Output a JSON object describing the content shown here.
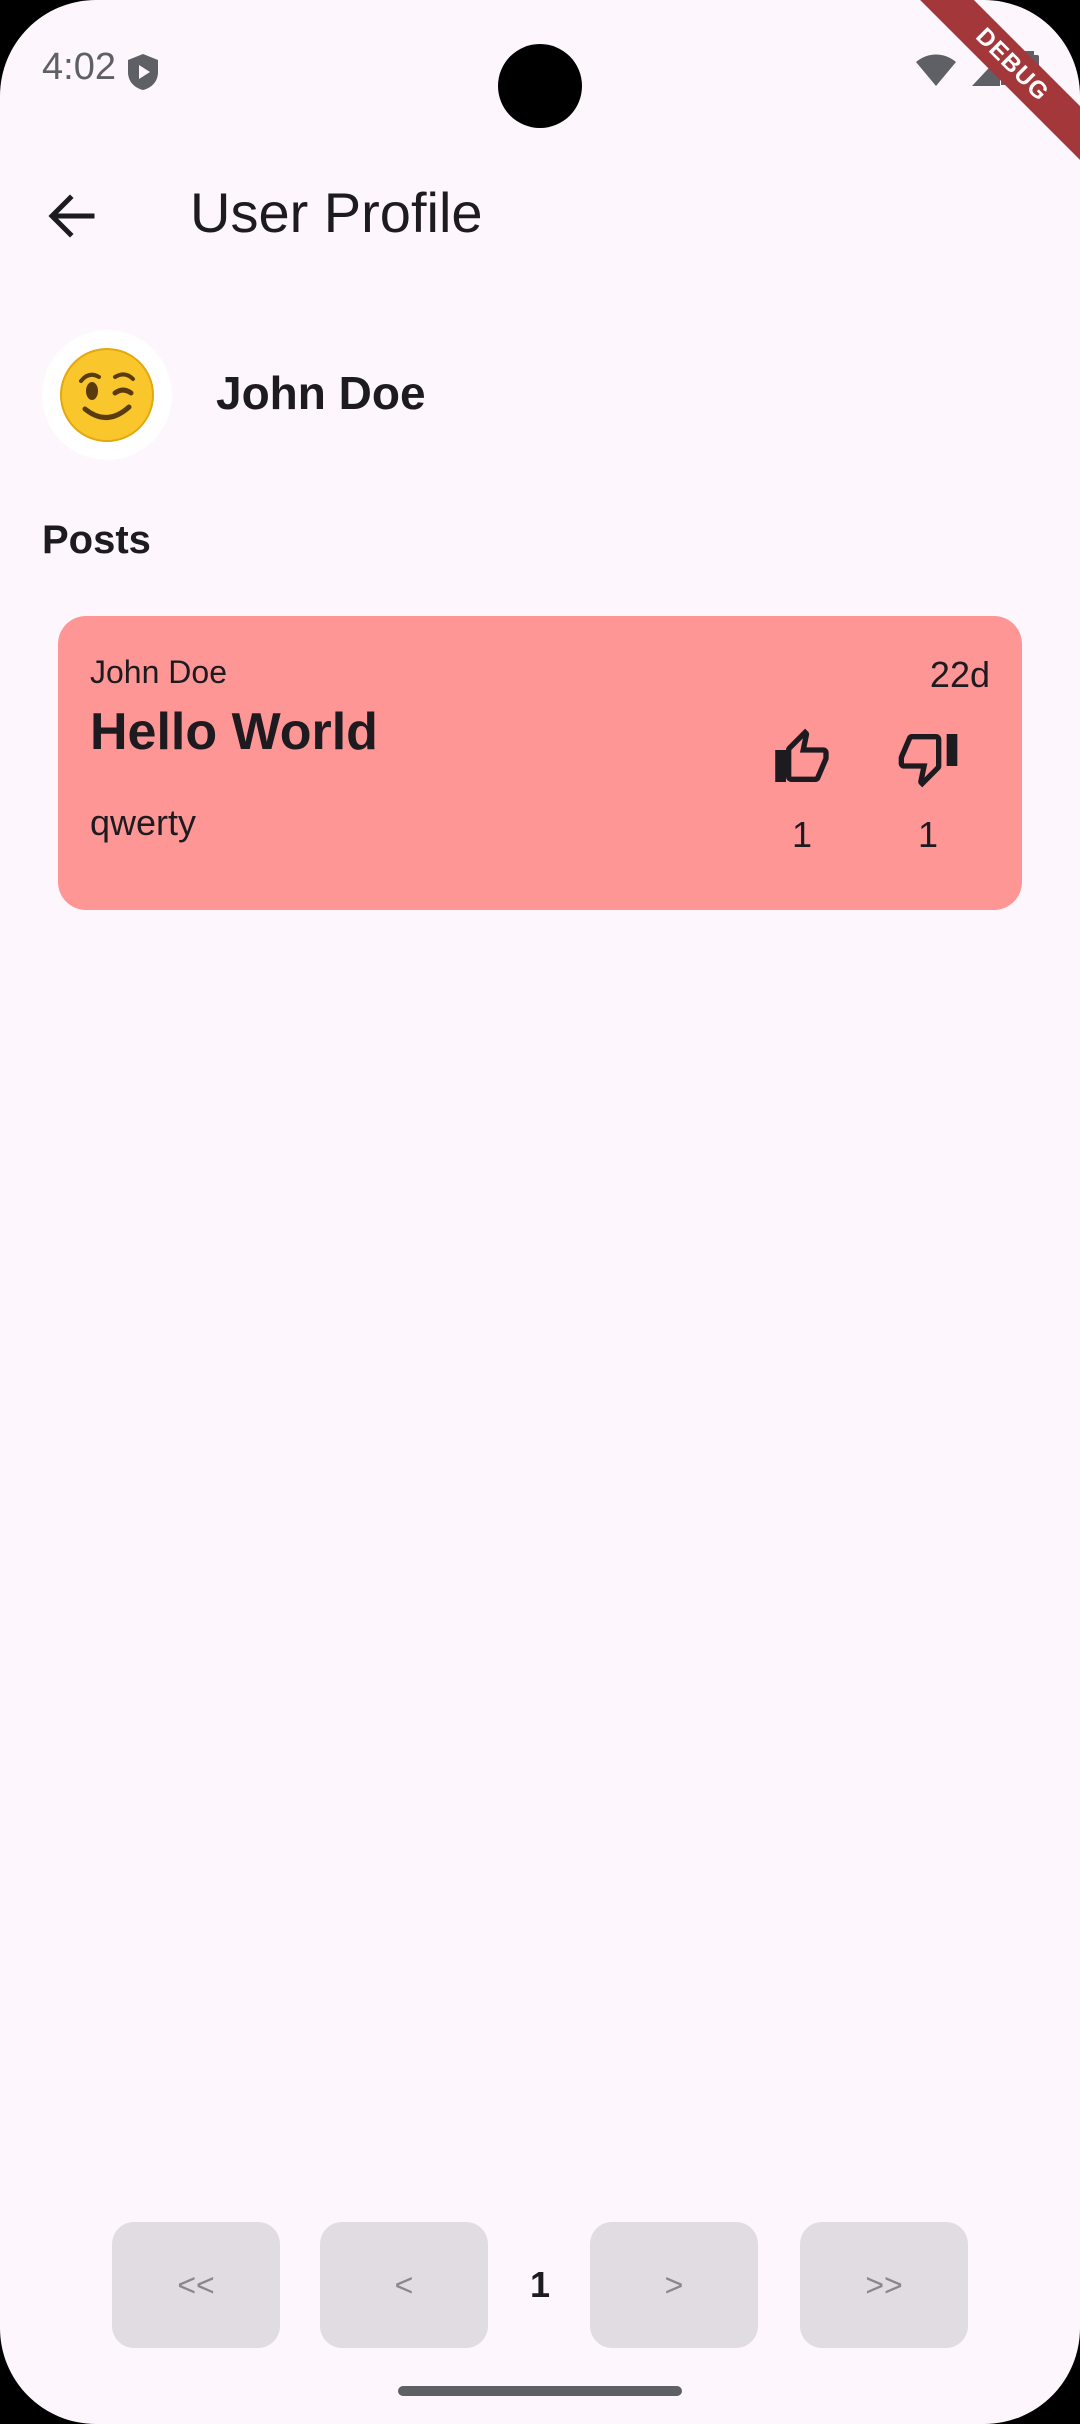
{
  "status_bar": {
    "time": "4:02"
  },
  "debug_banner": "DEBUG",
  "app_bar": {
    "title": "User Profile"
  },
  "profile": {
    "avatar_emoji": "😉",
    "name": "John Doe"
  },
  "posts_section": {
    "title": "Posts"
  },
  "posts": [
    {
      "author": "John Doe",
      "time_ago": "22d",
      "title": "Hello World",
      "body": "qwerty",
      "likes": "1",
      "dislikes": "1"
    }
  ],
  "pagination": {
    "first_label": "<<",
    "prev_label": "<",
    "current_page": "1",
    "next_label": ">",
    "last_label": ">>"
  },
  "colors": {
    "background": "#fdf6fd",
    "card": "#fe9696",
    "debug_ribbon": "#a4373a",
    "pager_button": "#e0dce2"
  }
}
